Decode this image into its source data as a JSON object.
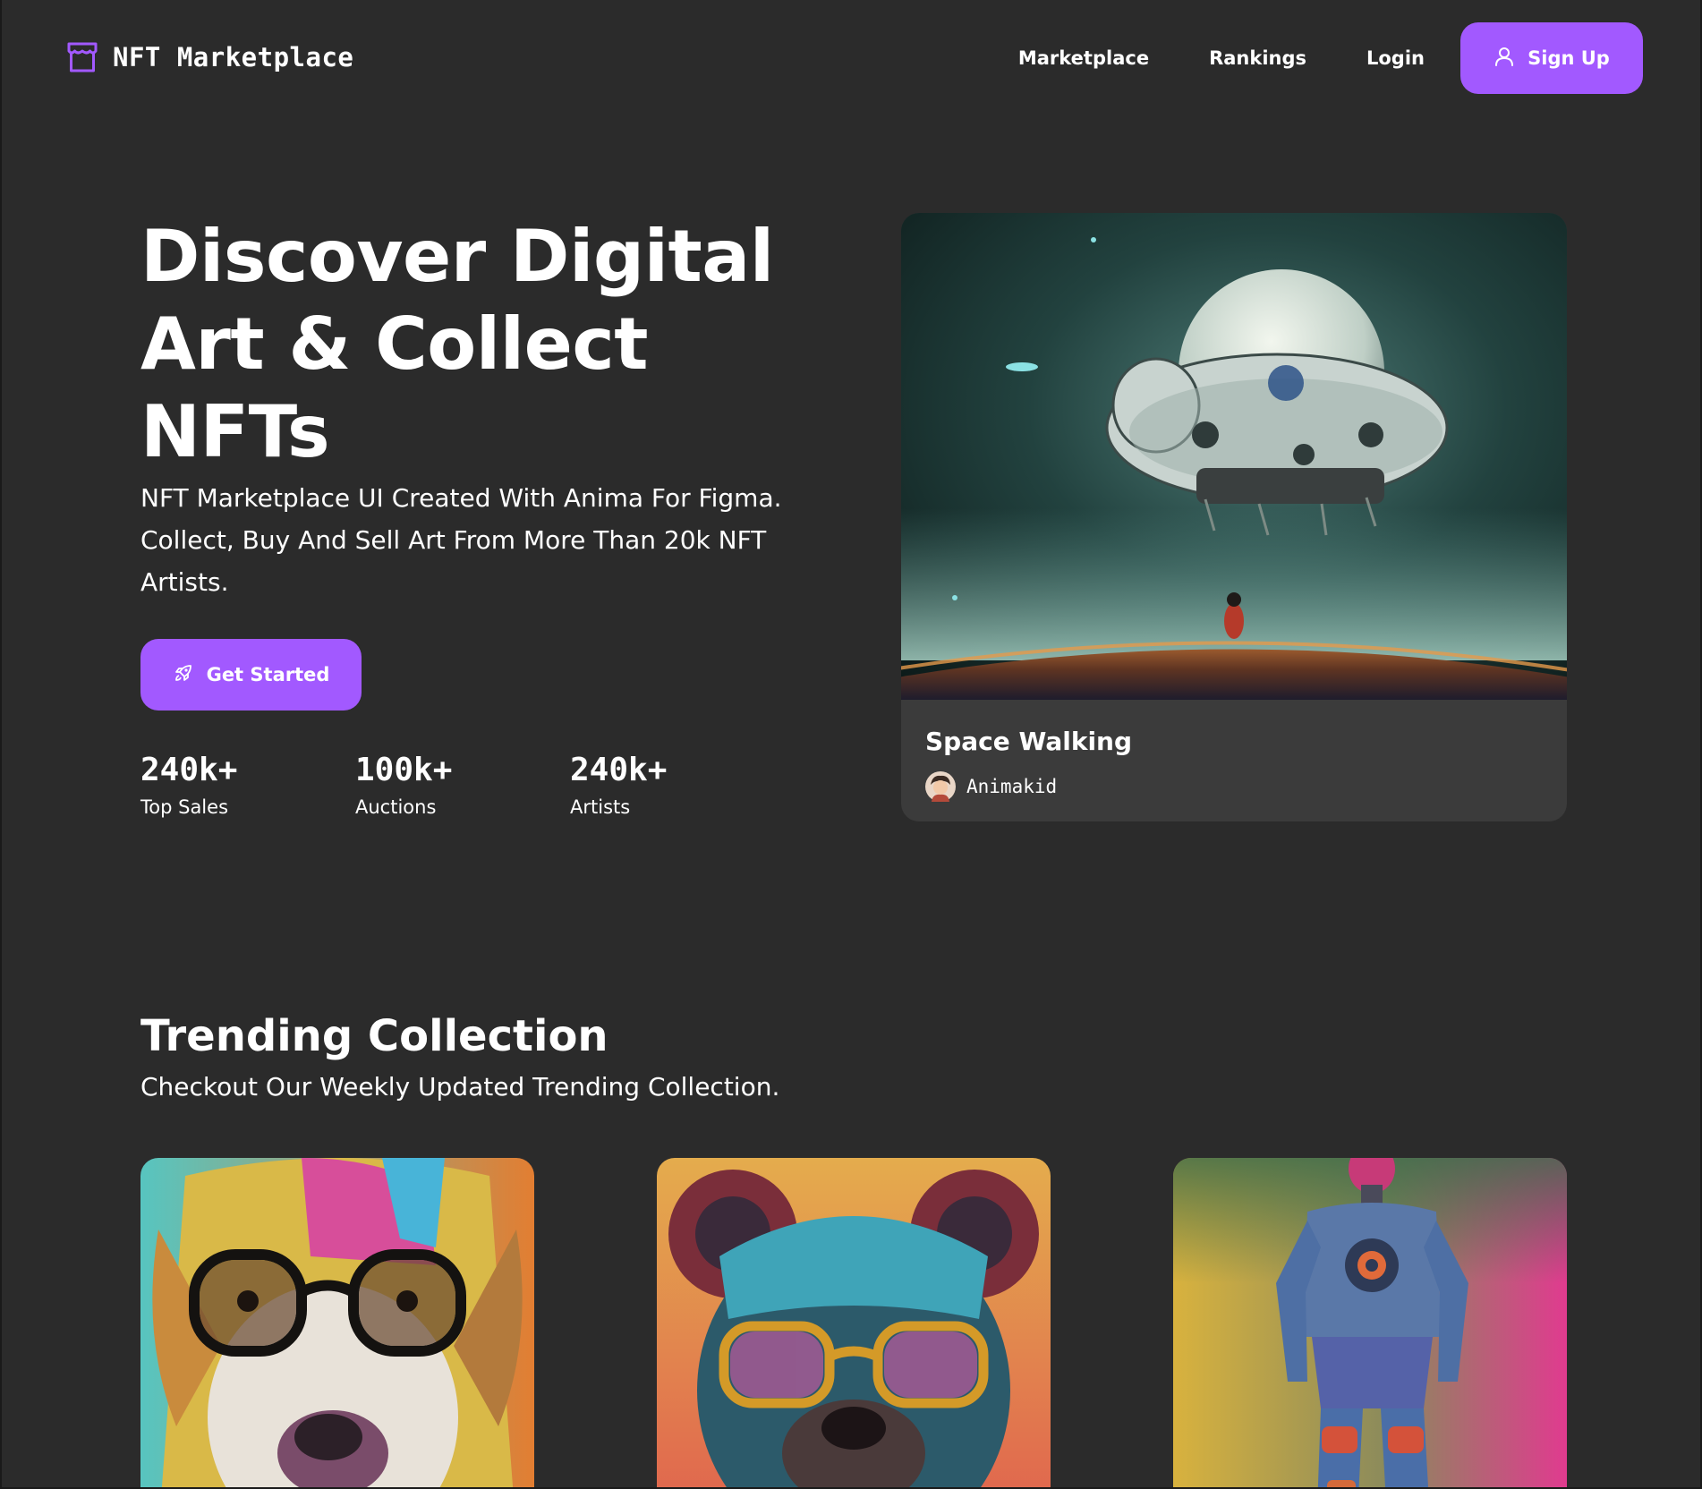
{
  "nav": {
    "brand": "NFT Marketplace",
    "links": [
      "Marketplace",
      "Rankings",
      "Login"
    ],
    "signup_label": "Sign Up"
  },
  "hero": {
    "title": "Discover Digital Art & Collect NFTs",
    "subtitle": "NFT Marketplace UI Created With Anima For Figma. Collect, Buy And Sell Art From More Than 20k NFT Artists.",
    "cta_label": "Get Started",
    "stats": [
      {
        "value": "240k+",
        "label": "Top Sales"
      },
      {
        "value": "100k+",
        "label": "Auctions"
      },
      {
        "value": "240k+",
        "label": "Artists"
      }
    ],
    "card": {
      "title": "Space Walking",
      "artist": "Animakid"
    }
  },
  "trending": {
    "title": "Trending Collection",
    "subtitle": "Checkout Our Weekly Updated Trending Collection."
  },
  "colors": {
    "background": "#2b2b2b",
    "card": "#3b3b3b",
    "accent": "#a259ff"
  },
  "icons": {
    "brand": "storefront-icon",
    "signup": "user-icon",
    "cta": "rocket-icon"
  }
}
